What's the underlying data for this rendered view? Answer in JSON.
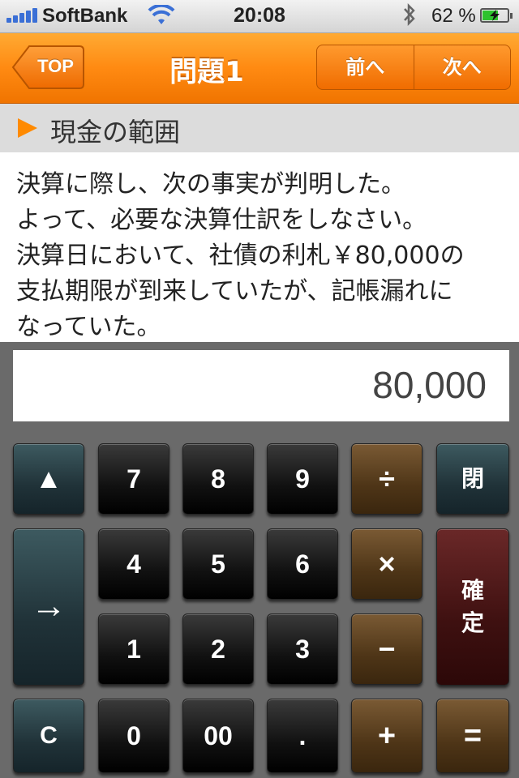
{
  "status_bar": {
    "carrier": "SoftBank",
    "time": "20:08",
    "battery_percent": "62 %",
    "battery_level": 0.62
  },
  "nav": {
    "back_label": "TOP",
    "title": "問題1",
    "prev_label": "前へ",
    "next_label": "次へ"
  },
  "section": {
    "title": "現金の範囲"
  },
  "question": {
    "lines": [
      "決算に際し、次の事実が判明した。",
      "よって、必要な決算仕訳をしなさい。",
      "決算日において、社債の利札￥80,000の",
      "支払期限が到来していたが、記帳漏れに",
      "なっていた。"
    ]
  },
  "calculator": {
    "display": "80,000",
    "keys": {
      "up": "▲",
      "arrow": "→",
      "clear": "C",
      "k7": "7",
      "k8": "8",
      "k9": "9",
      "k4": "4",
      "k5": "5",
      "k6": "6",
      "k1": "1",
      "k2": "2",
      "k3": "3",
      "k0": "0",
      "k00": "00",
      "dot": ".",
      "divide": "÷",
      "multiply": "×",
      "minus": "−",
      "plus": "+",
      "close": "閉",
      "confirm_top": "確",
      "confirm_bottom": "定",
      "equals": "="
    }
  }
}
